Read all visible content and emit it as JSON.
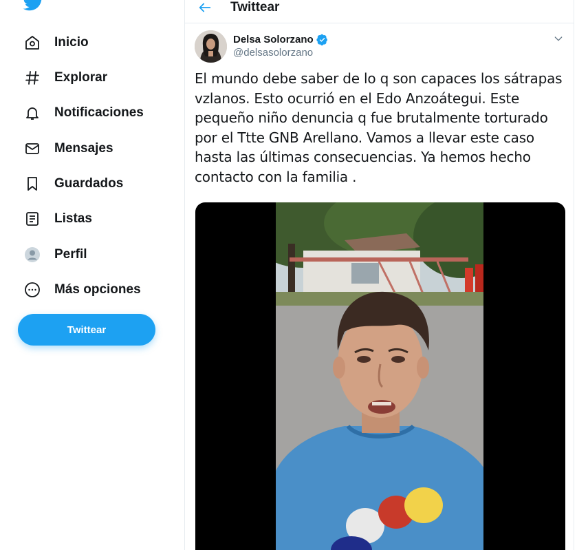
{
  "sidebar": {
    "items": [
      {
        "label": "Inicio",
        "icon": "home-icon"
      },
      {
        "label": "Explorar",
        "icon": "hashtag-icon"
      },
      {
        "label": "Notificaciones",
        "icon": "bell-icon"
      },
      {
        "label": "Mensajes",
        "icon": "envelope-icon"
      },
      {
        "label": "Guardados",
        "icon": "bookmark-icon"
      },
      {
        "label": "Listas",
        "icon": "list-icon"
      },
      {
        "label": "Perfil",
        "icon": "profile-icon"
      },
      {
        "label": "Más opciones",
        "icon": "more-icon"
      }
    ],
    "tweet_button": "Twittear"
  },
  "header": {
    "title": "Twittear"
  },
  "tweet": {
    "author_name": "Delsa Solorzano",
    "author_handle": "@delsasolorzano",
    "text": "El mundo debe saber de lo q son capaces los sátrapas vzlanos. Esto ocurrió en el Edo Anzoátegui. Este pequeño niño denuncia q fue brutalmente torturado por el Ttte GNB Arellano. Vamos a llevar este caso hasta las últimas consecuencias. Ya hemos hecho contacto con la familia ."
  },
  "colors": {
    "accent": "#1da1f2",
    "text": "#14171a",
    "secondary_text": "#657786",
    "border": "#e6ecf0"
  }
}
